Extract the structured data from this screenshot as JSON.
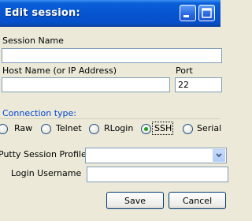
{
  "window": {
    "title": "Edit session:"
  },
  "fields": {
    "session_name_label": "Session Name",
    "session_name_value": "",
    "host_label": "Host Name (or IP Address)",
    "host_value": "",
    "port_label": "Port",
    "port_value": "22"
  },
  "connection": {
    "label": "Connection type:",
    "options": [
      "Raw",
      "Telnet",
      "RLogin",
      "SSH",
      "Serial"
    ],
    "selected": "SSH"
  },
  "putty_profile": {
    "label": "Putty Session Profile",
    "value": ""
  },
  "login": {
    "label": "Login Username",
    "value": ""
  },
  "buttons": {
    "save": "Save",
    "cancel": "Cancel"
  },
  "colors": {
    "titlebar": "#0654d1",
    "group_label": "#0046d5",
    "radio_dot": "#21a121"
  }
}
